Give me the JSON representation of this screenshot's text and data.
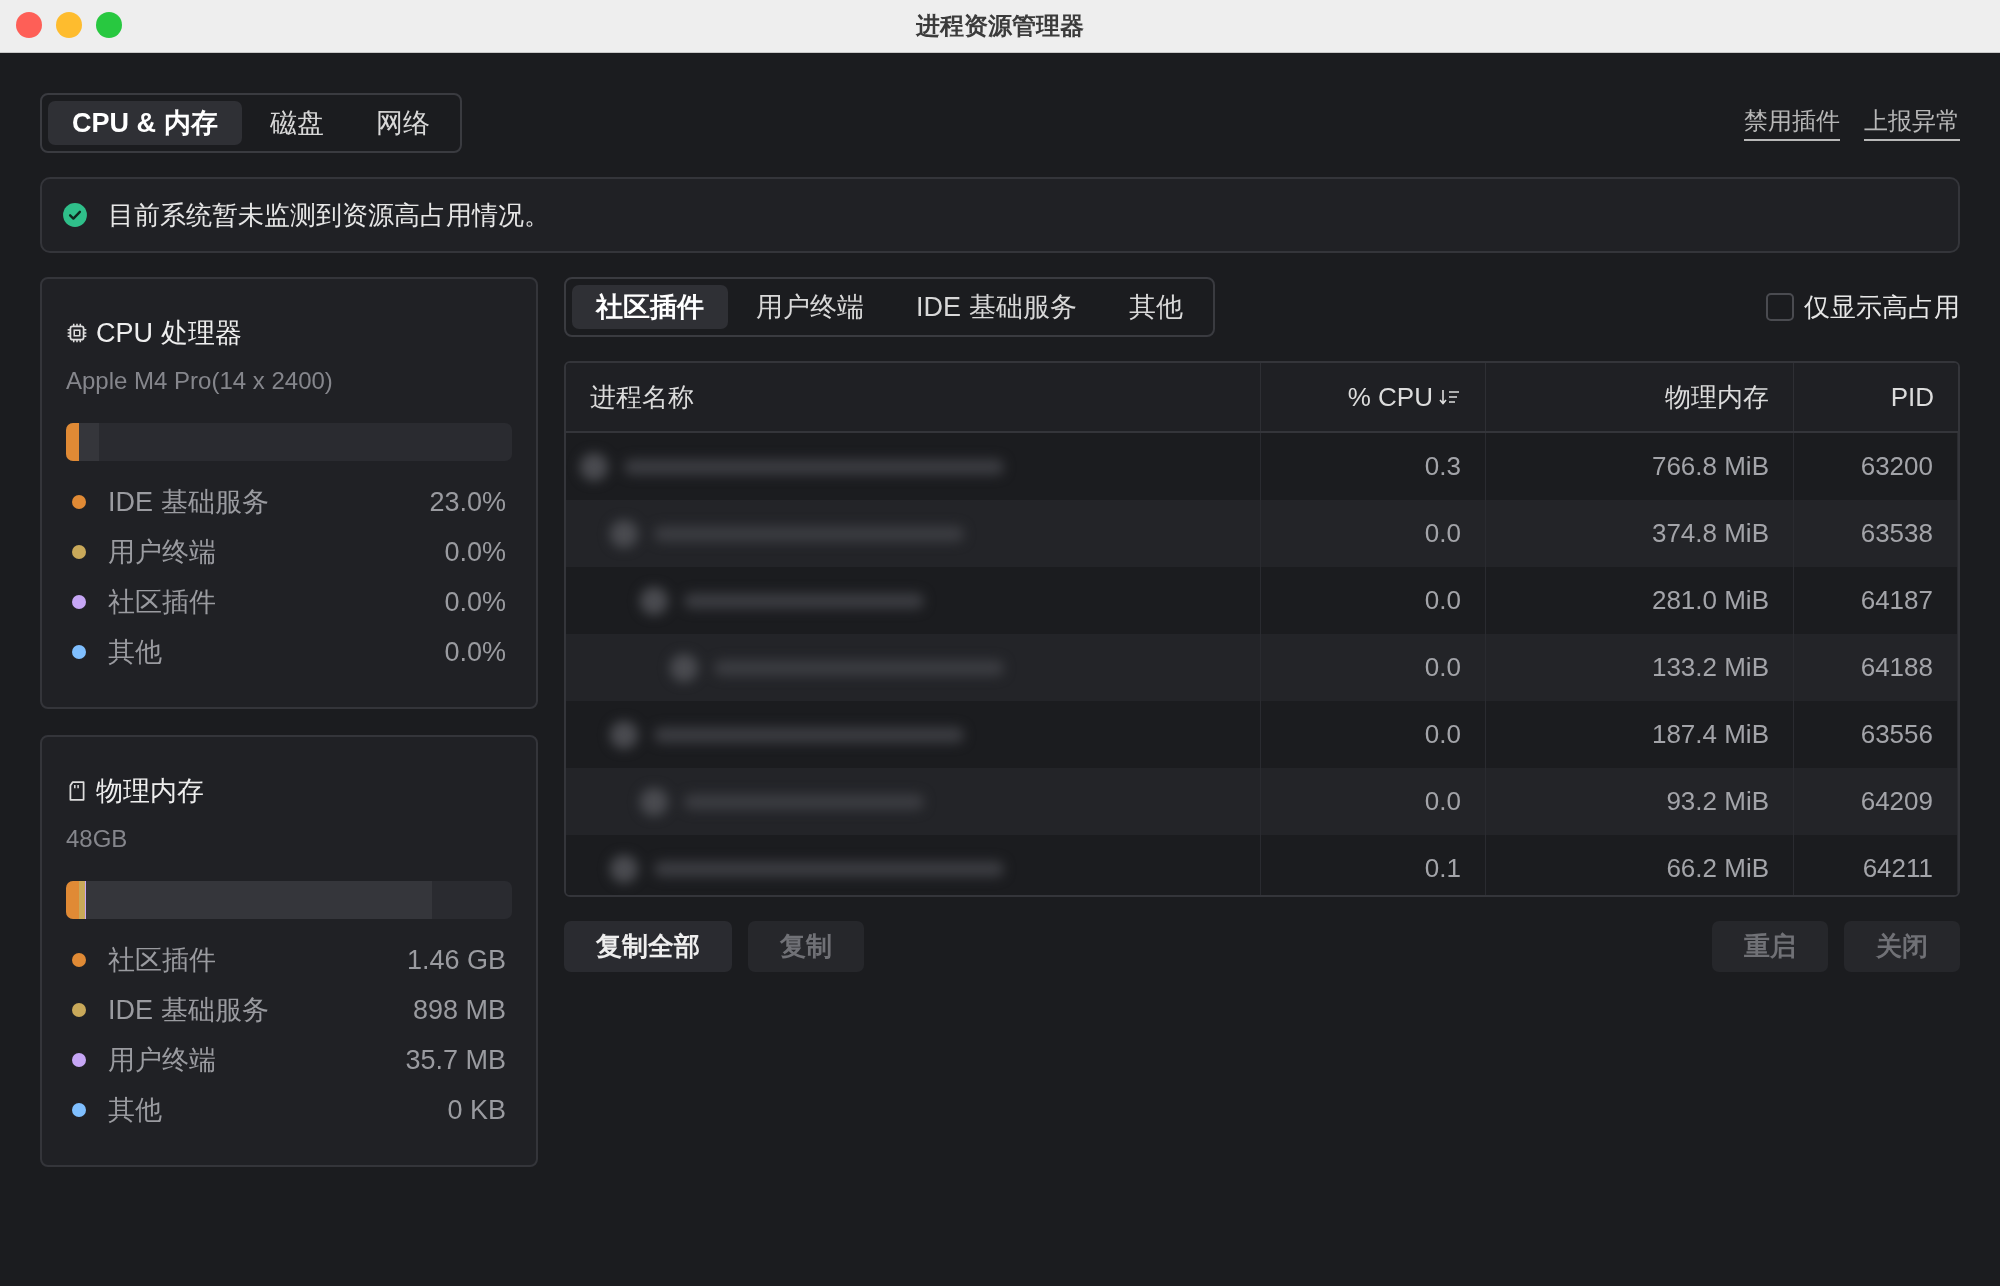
{
  "window": {
    "title": "进程资源管理器"
  },
  "tabs": [
    {
      "label": "CPU & 内存",
      "selected": true
    },
    {
      "label": "磁盘",
      "selected": false
    },
    {
      "label": "网络",
      "selected": false
    }
  ],
  "header_links": [
    "禁用插件",
    "上报异常"
  ],
  "banner": {
    "text": "目前系统暂未监测到资源高占用情况。"
  },
  "cards": [
    {
      "kind": "cpu",
      "title": "CPU 处理器",
      "subtitle": "Apple M4 Pro(14 x 2400)",
      "level": 0.075,
      "items": [
        {
          "label": "IDE 基础服务",
          "value": "23.0%",
          "color": "#e08a35",
          "level": 0.03
        },
        {
          "label": "用户终端",
          "value": "0.0%",
          "color": "#c9a95a"
        },
        {
          "label": "社区插件",
          "value": "0.0%",
          "color": "#c6a6f5"
        },
        {
          "label": "其他",
          "value": "0.0%",
          "color": "#7fbfff"
        }
      ]
    },
    {
      "kind": "memory",
      "title": "物理内存",
      "subtitle": "48GB",
      "level": 0.82,
      "items": [
        {
          "label": "社区插件",
          "value": "1.46 GB",
          "color": "#e08a35",
          "level": 0.03
        },
        {
          "label": "IDE 基础服务",
          "value": "898 MB",
          "color": "#c9a95a",
          "level": 0.012
        },
        {
          "label": "用户终端",
          "value": "35.7 MB",
          "color": "#c6a6f5",
          "level": 0.003
        },
        {
          "label": "其他",
          "value": "0 KB",
          "color": "#7fbfff"
        }
      ]
    }
  ],
  "sub_tabs": [
    {
      "label": "社区插件",
      "selected": true
    },
    {
      "label": "用户终端",
      "selected": false
    },
    {
      "label": "IDE 基础服务",
      "selected": false
    },
    {
      "label": "其他",
      "selected": false
    }
  ],
  "filter": {
    "label": "仅显示高占用",
    "checked": false
  },
  "table": {
    "columns": [
      {
        "label": "进程名称",
        "sorted": false
      },
      {
        "label": "% CPU",
        "sorted": true
      },
      {
        "label": "物理内存",
        "sorted": false
      },
      {
        "label": "PID",
        "sorted": false
      }
    ],
    "rows": [
      {
        "cpu": "0.3",
        "memory": "766.8 MiB",
        "pid": "63200",
        "children": [
          {
            "cpu": "0.0",
            "memory": "374.8 MiB",
            "pid": "63538",
            "children": [
              {
                "cpu": "0.0",
                "memory": "281.0 MiB",
                "pid": "64187",
                "children": [
                  {
                    "cpu": "0.0",
                    "memory": "133.2 MiB",
                    "pid": "64188"
                  }
                ]
              }
            ]
          },
          {
            "cpu": "0.0",
            "memory": "187.4 MiB",
            "pid": "63556",
            "children": [
              {
                "cpu": "0.0",
                "memory": "93.2 MiB",
                "pid": "64209"
              }
            ]
          },
          {
            "cpu": "0.1",
            "memory": "66.2 MiB",
            "pid": "64211"
          }
        ]
      }
    ]
  },
  "buttons_left": [
    {
      "label": "复制全部",
      "disabled": false
    },
    {
      "label": "复制",
      "disabled": true
    }
  ],
  "buttons_right": [
    {
      "label": "重启",
      "disabled": true
    },
    {
      "label": "关闭",
      "disabled": true
    }
  ]
}
